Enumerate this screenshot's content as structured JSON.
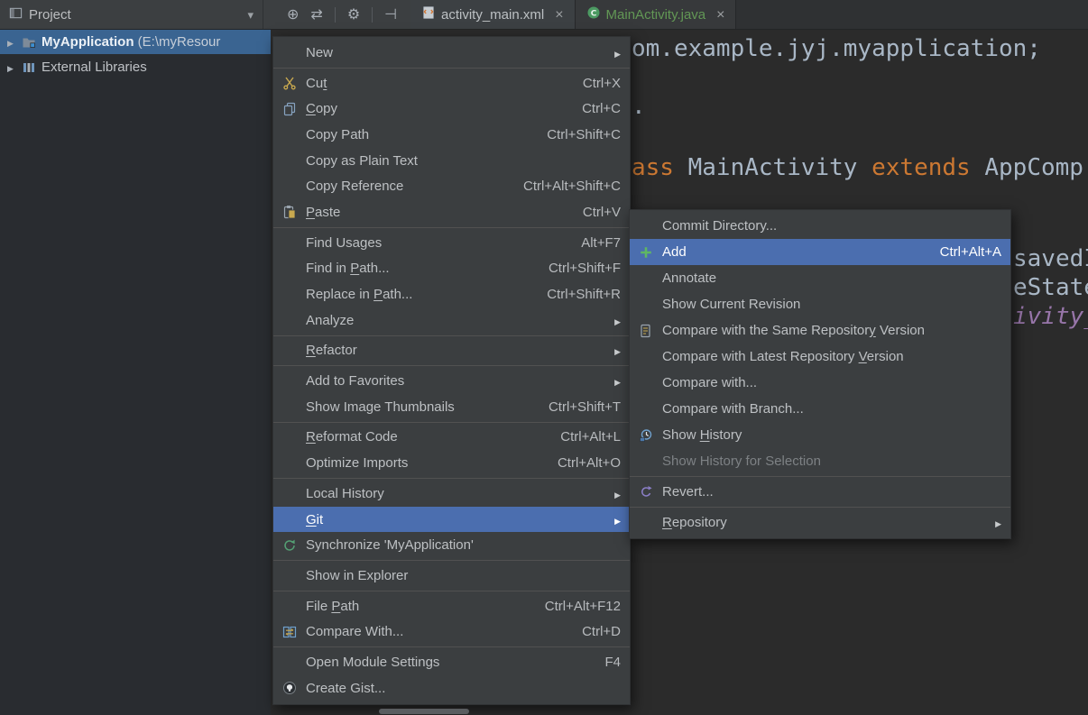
{
  "topbar": {
    "project_header": {
      "title": "Project"
    },
    "toolbar_icons": [
      {
        "name": "locate-icon",
        "glyph": "⊕"
      },
      {
        "name": "sync-scroll-icon",
        "glyph": "⇄"
      },
      {
        "name": "settings-icon",
        "glyph": "⚙"
      },
      {
        "name": "hide-panel-icon",
        "glyph": "⊣"
      }
    ],
    "tabs": [
      {
        "label": "activity_main.xml",
        "active": false
      },
      {
        "label": "MainActivity.java",
        "active": true
      }
    ]
  },
  "project_panel": {
    "items": [
      {
        "label": "MyApplication",
        "suffix": " (E:\\myResour",
        "selected": true
      },
      {
        "label": "External Libraries",
        "suffix": "",
        "selected": false
      }
    ]
  },
  "editor": {
    "package_line": "om.example.jyj.myapplication;",
    "stray_dot": ".",
    "class_line_parts": [
      {
        "text": "ass "
      },
      {
        "text": "MainActivity "
      },
      {
        "text": "extends "
      },
      {
        "text": "AppComp"
      }
    ],
    "fragments": [
      {
        "text": "savedI"
      },
      {
        "text": "eState"
      },
      {
        "text": "ivity_"
      }
    ]
  },
  "context_menu": {
    "items": [
      {
        "label": "New",
        "submenu": true
      },
      {
        "sep": true
      },
      {
        "label": "Cut",
        "shortcut": "Ctrl+X",
        "u": 2
      },
      {
        "label": "Copy",
        "shortcut": "Ctrl+C",
        "u": 0
      },
      {
        "label": "Copy Path",
        "shortcut": "Ctrl+Shift+C"
      },
      {
        "label": "Copy as Plain Text"
      },
      {
        "label": "Copy Reference",
        "shortcut": "Ctrl+Alt+Shift+C"
      },
      {
        "label": "Paste",
        "shortcut": "Ctrl+V",
        "u": 0
      },
      {
        "sep": true
      },
      {
        "label": "Find Usages",
        "shortcut": "Alt+F7"
      },
      {
        "label": "Find in Path...",
        "shortcut": "Ctrl+Shift+F",
        "u": 8
      },
      {
        "label": "Replace in Path...",
        "shortcut": "Ctrl+Shift+R",
        "u": 11
      },
      {
        "label": "Analyze",
        "submenu": true
      },
      {
        "sep": true
      },
      {
        "label": "Refactor",
        "submenu": true,
        "u": 0
      },
      {
        "sep": true
      },
      {
        "label": "Add to Favorites",
        "submenu": true
      },
      {
        "label": "Show Image Thumbnails",
        "shortcut": "Ctrl+Shift+T"
      },
      {
        "sep": true
      },
      {
        "label": "Reformat Code",
        "shortcut": "Ctrl+Alt+L",
        "u": 0
      },
      {
        "label": "Optimize Imports",
        "shortcut": "Ctrl+Alt+O"
      },
      {
        "sep": true
      },
      {
        "label": "Local History",
        "submenu": true
      },
      {
        "label": "Git",
        "submenu": true,
        "selected": true,
        "u": 0
      },
      {
        "label": "Synchronize 'MyApplication'"
      },
      {
        "sep": true
      },
      {
        "label": "Show in Explorer"
      },
      {
        "sep": true
      },
      {
        "label": "File Path",
        "shortcut": "Ctrl+Alt+F12",
        "u": 5
      },
      {
        "label": "Compare With...",
        "shortcut": "Ctrl+D"
      },
      {
        "sep": true
      },
      {
        "label": "Open Module Settings",
        "shortcut": "F4"
      },
      {
        "label": "Create Gist..."
      }
    ]
  },
  "git_submenu": {
    "items": [
      {
        "label": "Commit Directory..."
      },
      {
        "label": "Add",
        "shortcut": "Ctrl+Alt+A",
        "selected": true
      },
      {
        "label": "Annotate"
      },
      {
        "label": "Show Current Revision"
      },
      {
        "label": "Compare with the Same Repository Version",
        "u": 31
      },
      {
        "label": "Compare with Latest Repository Version",
        "u": 31
      },
      {
        "label": "Compare with..."
      },
      {
        "label": "Compare with Branch..."
      },
      {
        "label": "Show History",
        "u": 5
      },
      {
        "label": "Show History for Selection",
        "disabled": true
      },
      {
        "sep": true
      },
      {
        "label": "Revert..."
      },
      {
        "sep": true
      },
      {
        "label": "Repository",
        "submenu": true,
        "u": 0
      }
    ]
  },
  "colors": {
    "bar_bg": "#3C3F41",
    "editor_bg": "#2B2B2B",
    "menu_bg": "#3B3E40",
    "menu_selection_blue": "#4B6EAF",
    "tree_selection_blue": "#3A6491",
    "keyword_orange": "#CC7832",
    "code_text": "#A9B7C6",
    "field_purple": "#9876AA",
    "added_file_green": "#629755"
  }
}
